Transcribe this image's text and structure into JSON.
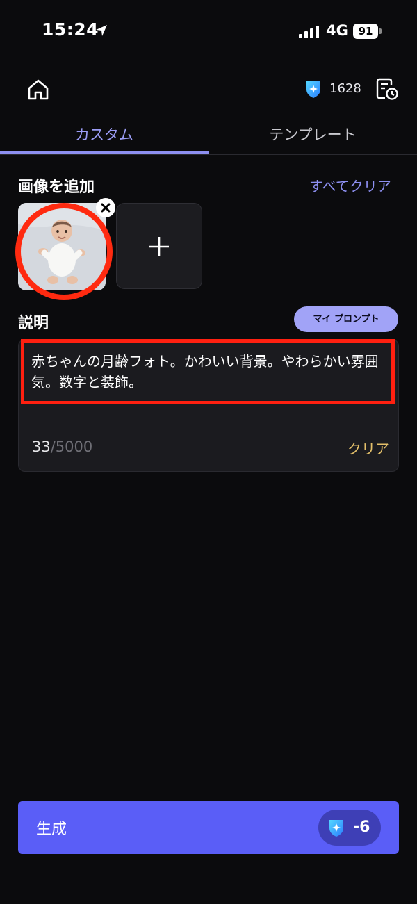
{
  "status_bar": {
    "time": "15:24",
    "network": "4G",
    "battery": "91"
  },
  "header": {
    "credits": "1628"
  },
  "tabs": [
    {
      "label": "カスタム",
      "active": true
    },
    {
      "label": "テンプレート",
      "active": false
    }
  ],
  "images": {
    "title": "画像を追加",
    "clear_all": "すべてクリア"
  },
  "description": {
    "title": "説明",
    "my_prompt": "マイ プロンプト",
    "text": "赤ちゃんの月齢フォト。かわいい背景。やわらかい雰囲気。数字と装飾。",
    "count_used": "33",
    "count_max": "/5000",
    "clear": "クリア"
  },
  "generate": {
    "label": "生成",
    "cost": "-6"
  },
  "colors": {
    "accent": "#5a5ef7",
    "highlight": "#ff2a10",
    "clear": "#e4c06a"
  }
}
